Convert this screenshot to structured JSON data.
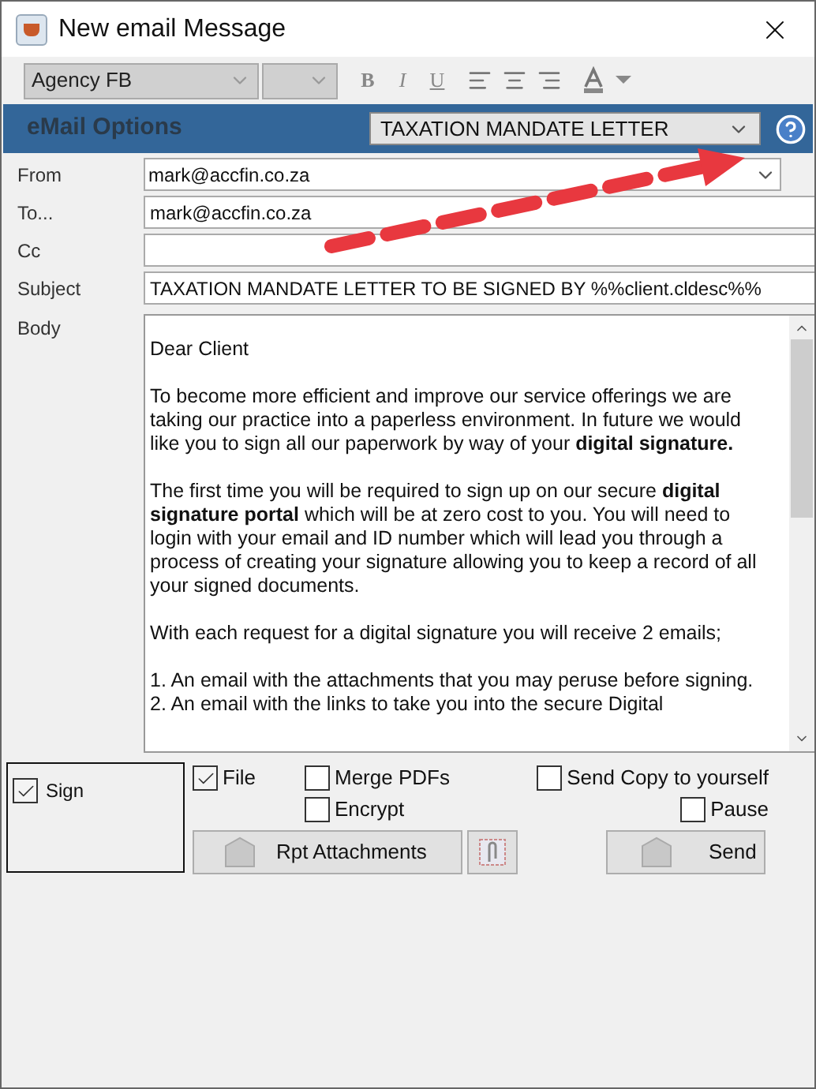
{
  "window": {
    "title": "New email Message"
  },
  "toolbar": {
    "font": "Agency FB",
    "format_buttons": [
      "B",
      "I",
      "U"
    ]
  },
  "options_bar": {
    "title": "eMail Options",
    "template": "TAXATION MANDATE LETTER"
  },
  "fields": [
    {
      "label": "From",
      "value": "mark@accfin.co.za",
      "kind": "dropdown"
    },
    {
      "label": "To...",
      "value": "mark@accfin.co.za",
      "kind": "text"
    },
    {
      "label": "Cc",
      "kind": "text"
    },
    {
      "label": "Subject",
      "value": "TAXATION MANDATE LETTER TO BE SIGNED BY %%client.cldesc%%",
      "kind": "text"
    }
  ],
  "body": {
    "label": "Body",
    "paragraphs": [
      "Dear Client",
      "To become more efficient and improve our service offerings we are taking our practice into a paperless environment. In future we would like you to sign all our paperwork by way of your **digital signature.**",
      "The first time you will be required to sign up on our secure **digital signature portal** which will be at zero cost to you. You will need to login with your email and ID number which will lead you through a process of creating your signature allowing you to keep a record of all your signed documents.",
      "With each request for a digital signature you will receive 2 emails;",
      "1. An email with the attachments that you may peruse before signing.\n2. An email with the links to take you into the secure Digital"
    ]
  },
  "sign": {
    "label": "Sign",
    "checked": true
  },
  "left_checkboxes": [
    {
      "label": "File",
      "checked": true
    }
  ],
  "middle_checkboxes": [
    {
      "label": "Merge PDFs",
      "checked": false
    },
    {
      "label": "Encrypt",
      "checked": false
    }
  ],
  "right_checkboxes": [
    {
      "label": "Send Copy to yourself",
      "checked": false
    },
    {
      "label": "Pause",
      "checked": false
    }
  ],
  "buttons": {
    "attachments": "Rpt Attachments",
    "send": "Send"
  }
}
